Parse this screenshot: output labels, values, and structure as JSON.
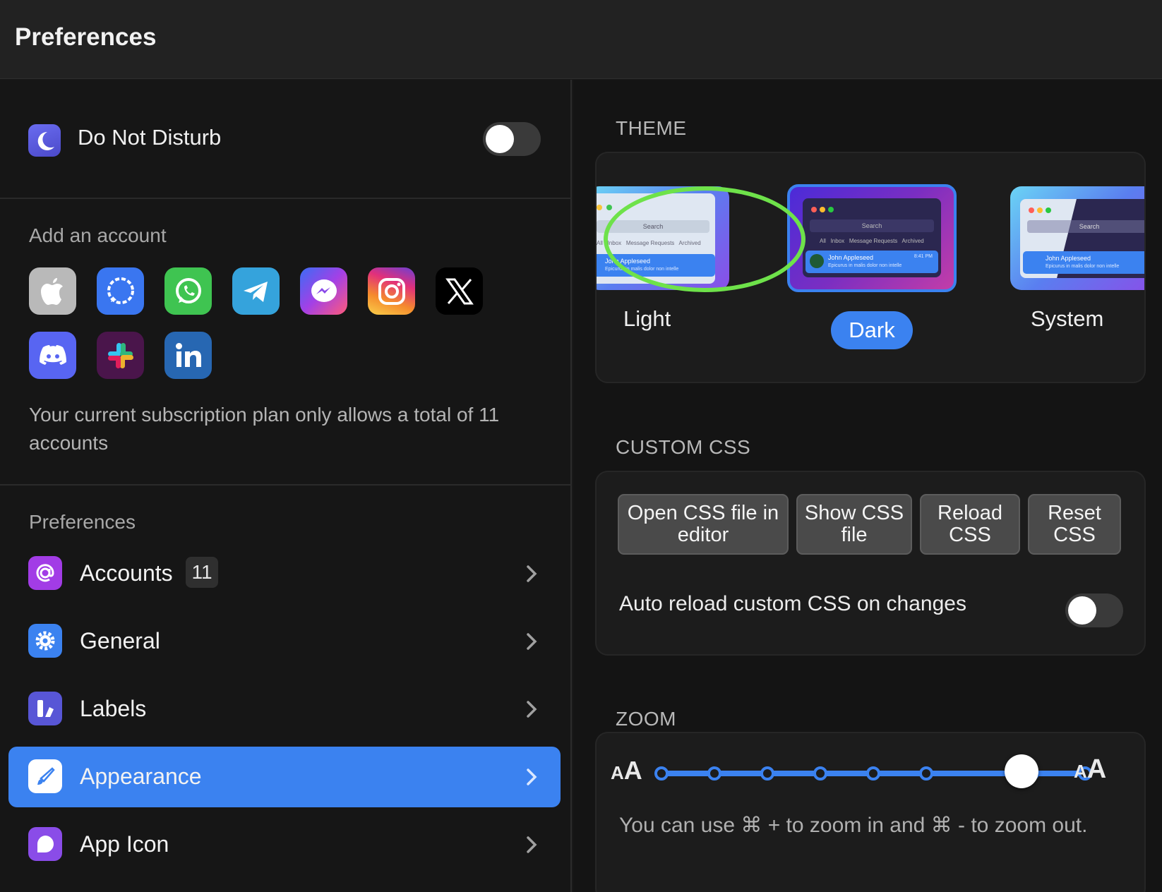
{
  "window": {
    "title": "Preferences"
  },
  "sidebar": {
    "dnd": {
      "label": "Do Not Disturb",
      "on": false
    },
    "add_account": {
      "heading": "Add an account",
      "services": [
        "apple-icon",
        "signal-icon",
        "whatsapp-icon",
        "telegram-icon",
        "messenger-icon",
        "instagram-icon",
        "x-icon",
        "discord-icon",
        "slack-icon",
        "linkedin-icon"
      ],
      "note": "Your current subscription plan only allows a total of 11 accounts"
    },
    "preferences": {
      "heading": "Preferences",
      "items": [
        {
          "label": "Accounts",
          "badge": "11",
          "icon": "at-icon"
        },
        {
          "label": "General",
          "icon": "gear-icon"
        },
        {
          "label": "Labels",
          "icon": "labels-icon"
        },
        {
          "label": "Appearance",
          "icon": "brush-icon",
          "active": true
        },
        {
          "label": "App Icon",
          "icon": "app-icon-icon"
        }
      ]
    }
  },
  "main": {
    "theme": {
      "heading": "THEME",
      "options": [
        "Light",
        "Dark",
        "System"
      ],
      "selected": "Dark",
      "preview": {
        "search": "Search",
        "tabs": [
          "All",
          "Inbox",
          "Message Requests",
          "Archived"
        ],
        "contact": "John Appleseed",
        "preview_text": "Epicurus in malis dolor non intelle",
        "time": "8:41 PM"
      }
    },
    "custom_css": {
      "heading": "CUSTOM CSS",
      "buttons": [
        "Open CSS file in editor",
        "Show CSS file",
        "Reload CSS",
        "Reset CSS"
      ],
      "auto_reload_label": "Auto reload custom CSS on changes",
      "auto_reload_on": false
    },
    "zoom": {
      "heading": "ZOOM",
      "small_label": "AA",
      "large_label": "AA",
      "steps": 9,
      "current_step": 6,
      "note": "You can use ⌘ + to zoom in and ⌘ - to zoom out."
    }
  },
  "colors": {
    "accent": "#3b82f0",
    "highlight_ring": "#6ee24a"
  }
}
